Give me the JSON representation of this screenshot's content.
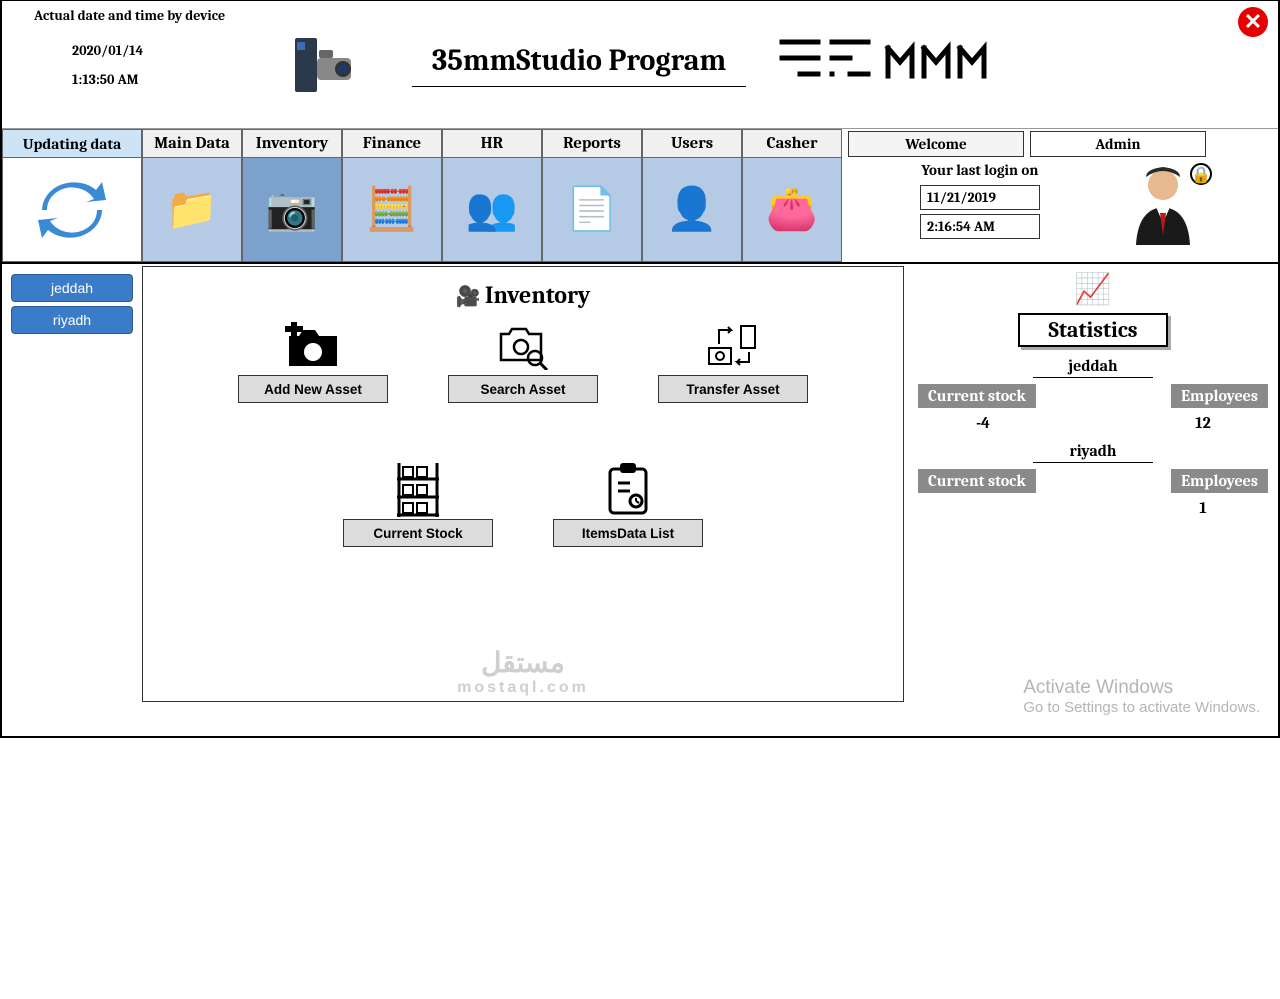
{
  "header": {
    "dt_label": "Actual date and time by device",
    "date": "2020/01/14",
    "time": "1:13:50 AM",
    "title": "35mmStudio Program",
    "brand": "35mm"
  },
  "toolbar": [
    {
      "label": "Updating data",
      "icon": "🔄"
    },
    {
      "label": "Main Data",
      "icon": "📁"
    },
    {
      "label": "Inventory",
      "icon": "📷"
    },
    {
      "label": "Finance",
      "icon": "🧮"
    },
    {
      "label": "HR",
      "icon": "👥"
    },
    {
      "label": "Reports",
      "icon": "📄"
    },
    {
      "label": "Users",
      "icon": "👤"
    },
    {
      "label": "Casher",
      "icon": "👛"
    }
  ],
  "branches": [
    "jeddah",
    "riyadh"
  ],
  "panel": {
    "title": "Inventory",
    "items": [
      {
        "label": "Add New Asset",
        "icon": "📷"
      },
      {
        "label": "Search Asset",
        "icon": "🔍"
      },
      {
        "label": "Transfer Asset",
        "icon": "🔁"
      },
      {
        "label": "Current Stock",
        "icon": "🗄️"
      },
      {
        "label": "ItemsData List",
        "icon": "📋"
      }
    ]
  },
  "right": {
    "welcome": "Welcome",
    "user": "Admin",
    "last_login_label": "Your last login on",
    "last_login_date": "11/21/2019",
    "last_login_time": "2:16:54 AM",
    "stats_label": "Statistics",
    "branches": [
      {
        "name": "jeddah",
        "stock_label": "Current stock",
        "stock": "-4",
        "emp_label": "Employees",
        "emp": "12"
      },
      {
        "name": "riyadh",
        "stock_label": "Current stock",
        "stock": "",
        "emp_label": "Employees",
        "emp": "1"
      }
    ]
  },
  "watermark": {
    "ar": "مستقل",
    "en": "mostaql.com"
  },
  "activate": {
    "line1": "Activate Windows",
    "line2": "Go to Settings to activate Windows."
  }
}
